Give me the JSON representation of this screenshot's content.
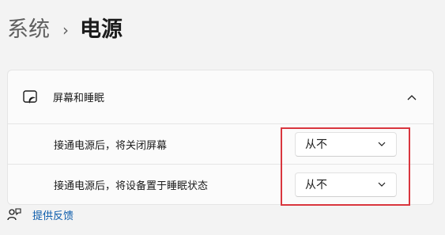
{
  "breadcrumb": {
    "parent": "系统",
    "separator": "›",
    "current": "电源"
  },
  "panel": {
    "icon": "screen-sleep-icon",
    "title": "屏幕和睡眠",
    "expanded": true,
    "rows": [
      {
        "label": "接通电源后，将关闭屏幕",
        "value": "从不"
      },
      {
        "label": "接通电源后，将设备置于睡眠状态",
        "value": "从不"
      }
    ]
  },
  "footer": {
    "feedback_icon": "feedback-icon",
    "feedback_label": "提供反馈"
  },
  "colors": {
    "highlight": "#d9363e",
    "link": "#0a5bab",
    "background": "#f3f3f3"
  }
}
